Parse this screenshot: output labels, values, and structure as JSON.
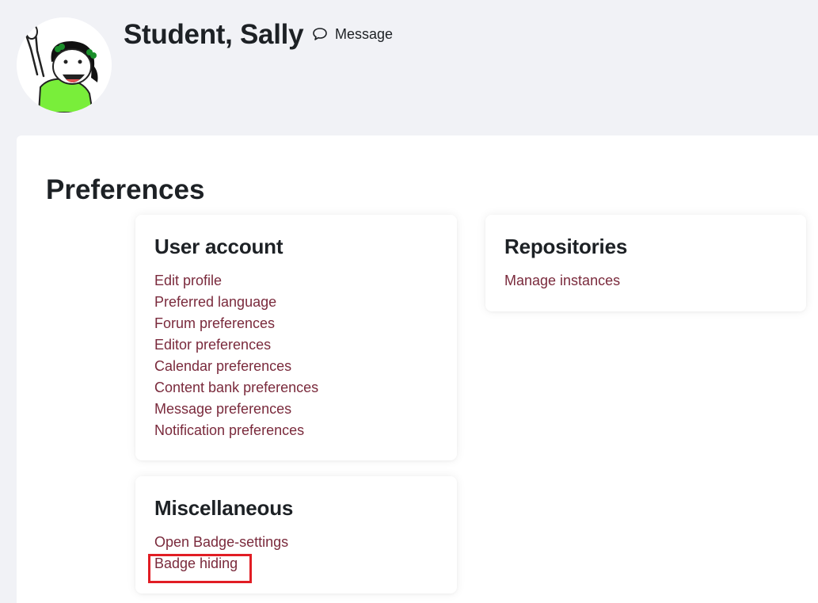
{
  "header": {
    "user_name": "Student, Sally",
    "message_label": "Message"
  },
  "main": {
    "title": "Preferences"
  },
  "cards": {
    "user_account": {
      "title": "User account",
      "links": [
        "Edit profile",
        "Preferred language",
        "Forum preferences",
        "Editor preferences",
        "Calendar preferences",
        "Content bank preferences",
        "Message preferences",
        "Notification preferences"
      ]
    },
    "repositories": {
      "title": "Repositories",
      "links": [
        "Manage instances"
      ]
    },
    "miscellaneous": {
      "title": "Miscellaneous",
      "links": [
        "Open Badge-settings",
        "Badge hiding"
      ]
    }
  },
  "colors": {
    "link": "#7a2a3c",
    "background": "#f1f2f6",
    "highlight": "#e11d24"
  },
  "icons": {
    "message": "speech-bubble-icon"
  }
}
